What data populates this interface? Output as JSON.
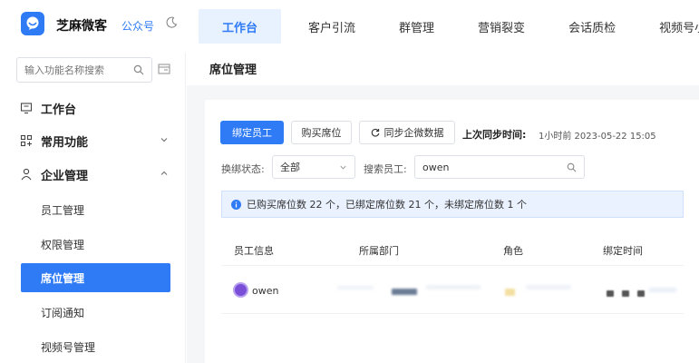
{
  "header": {
    "brand": "芝麻微客",
    "official_account_link": "公众号",
    "nav_tabs": [
      {
        "label": "工作台",
        "active": true
      },
      {
        "label": "客户引流",
        "active": false
      },
      {
        "label": "群管理",
        "active": false
      },
      {
        "label": "营销裂变",
        "active": false
      },
      {
        "label": "会话质检",
        "active": false
      },
      {
        "label": "视频号小",
        "active": false
      }
    ]
  },
  "sidebar": {
    "search_placeholder": "输入功能名称搜索",
    "groups": [
      {
        "label": "工作台",
        "icon": "monitor-icon"
      },
      {
        "label": "常用功能",
        "icon": "grid-icon",
        "expanded": false
      },
      {
        "label": "企业管理",
        "icon": "person-icon",
        "expanded": true
      }
    ],
    "sub_items": [
      {
        "label": "员工管理",
        "active": false
      },
      {
        "label": "权限管理",
        "active": false
      },
      {
        "label": "席位管理",
        "active": true
      },
      {
        "label": "订阅通知",
        "active": false
      },
      {
        "label": "视频号管理",
        "active": false
      }
    ]
  },
  "page": {
    "title": "席位管理",
    "buttons": {
      "bind": "绑定员工",
      "buy": "购买席位",
      "sync": "同步企微数据"
    },
    "last_sync_label": "上次同步时间:",
    "last_sync_value": "1小时前  2023-05-22 15:05",
    "filters": {
      "status_label": "换绑状态:",
      "status_value": "全部",
      "search_label": "搜索员工:",
      "search_value": "owen"
    },
    "notice": "已购买席位数 22 个，已绑定席位数 21 个，未绑定席位数 1 个",
    "table": {
      "columns": [
        "员工信息",
        "所属部门",
        "角色",
        "绑定时间"
      ],
      "rows": [
        {
          "name": "owen"
        }
      ]
    }
  },
  "colors": {
    "accent": "#2f7bf5",
    "active_tab_bg": "#e8f1fe",
    "notice_bg": "#eaf2ff",
    "page_bg": "#f5f6f8"
  }
}
